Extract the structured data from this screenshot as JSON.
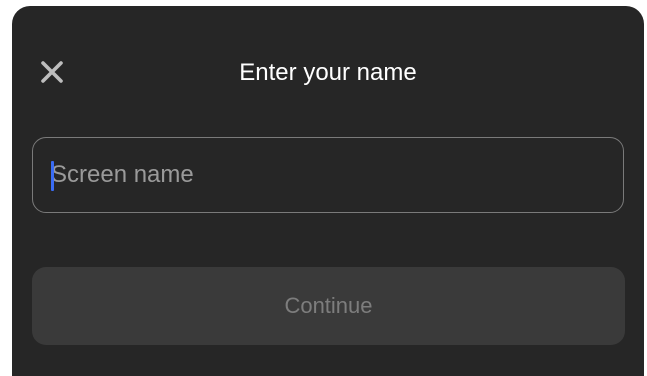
{
  "header": {
    "title": "Enter your name",
    "close_icon": "close-icon"
  },
  "name_field": {
    "value": "",
    "placeholder": "Screen name"
  },
  "actions": {
    "continue_label": "Continue",
    "continue_enabled": false
  },
  "colors": {
    "sheet_background": "#262626",
    "title_text": "#ffffff",
    "input_border": "#7a7a7a",
    "placeholder_text": "#9a9a9a",
    "caret": "#3a6cf4",
    "button_background_disabled": "#3a3a3a",
    "button_text_disabled": "#7d7d7d"
  }
}
